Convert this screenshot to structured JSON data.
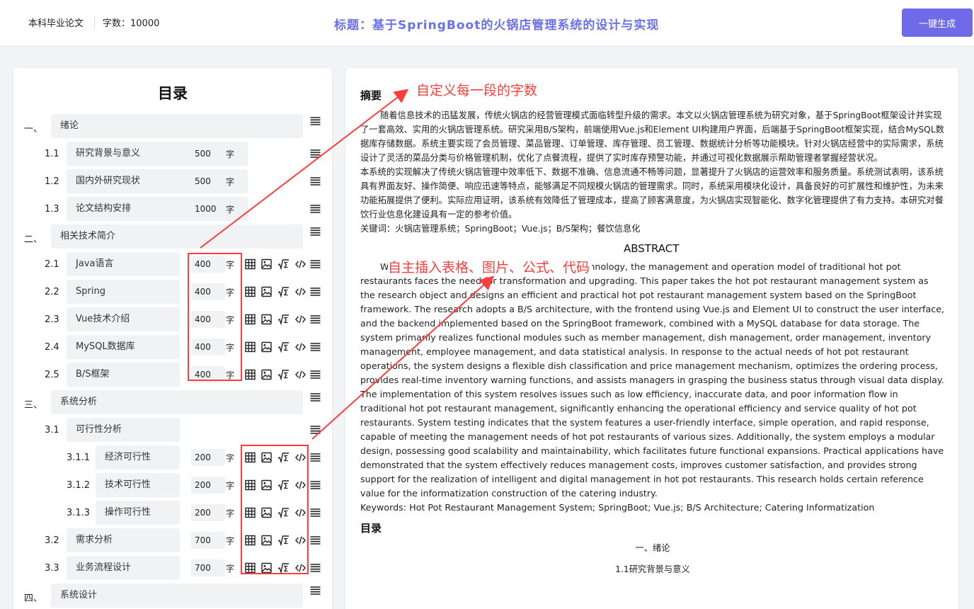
{
  "header": {
    "paper_type": "本科毕业论文",
    "word_count": "字数：10000",
    "title": "标题：基于SpringBoot的火锅店管理系统的设计与实现",
    "generate_button": "一键生成"
  },
  "toc": {
    "heading": "目录",
    "unit": "字",
    "items": [
      {
        "num": "一、",
        "label": "绪论"
      },
      {
        "num": "1.1",
        "label": "研究背景与意义",
        "words": "500"
      },
      {
        "num": "1.2",
        "label": "国内外研究现状",
        "words": "500"
      },
      {
        "num": "1.3",
        "label": "论文结构安排",
        "words": "1000"
      },
      {
        "num": "二、",
        "label": "相关技术简介"
      },
      {
        "num": "2.1",
        "label": "Java语言",
        "words": "400"
      },
      {
        "num": "2.2",
        "label": "Spring",
        "words": "400"
      },
      {
        "num": "2.3",
        "label": "Vue技术介绍",
        "words": "400"
      },
      {
        "num": "2.4",
        "label": "MySQL数据库",
        "words": "400"
      },
      {
        "num": "2.5",
        "label": "B/S框架",
        "words": "400"
      },
      {
        "num": "三、",
        "label": "系统分析"
      },
      {
        "num": "3.1",
        "label": "可行性分析"
      },
      {
        "num": "3.1.1",
        "label": "经济可行性",
        "words": "200"
      },
      {
        "num": "3.1.2",
        "label": "技术可行性",
        "words": "200"
      },
      {
        "num": "3.1.3",
        "label": "操作可行性",
        "words": "200"
      },
      {
        "num": "3.2",
        "label": "需求分析",
        "words": "700"
      },
      {
        "num": "3.3",
        "label": "业务流程设计",
        "words": "700"
      },
      {
        "num": "四、",
        "label": "系统设计"
      }
    ]
  },
  "annotations": {
    "custom_words": "自定义每一段的字数",
    "insert_media": "自主插入表格、图片、公式、代码"
  },
  "document": {
    "abstract_heading": "摘要",
    "abstract_p1": "随着信息技术的迅猛发展，传统火锅店的经营管理模式面临转型升级的需求。本文以火锅店管理系统为研究对象，基于SpringBoot框架设计并实现了一套高效、实用的火锅店管理系统。研究采用B/S架构，前端使用Vue.js和Element UI构建用户界面，后端基于SpringBoot框架实现，结合MySQL数据库存储数据。系统主要实现了会员管理、菜品管理、订单管理、库存管理、员工管理、数据统计分析等功能模块。针对火锅店经营中的实际需求，系统设计了灵活的菜品分类与价格管理机制，优化了点餐流程，提供了实时库存预警功能，并通过可视化数据展示帮助管理者掌握经营状况。",
    "abstract_p2": "本系统的实现解决了传统火锅店管理中效率低下、数据不准确、信息流通不畅等问题，显著提升了火锅店的运营效率和服务质量。系统测试表明，该系统具有界面友好、操作简便、响应迅速等特点，能够满足不同规模火锅店的管理需求。同时，系统采用模块化设计，具备良好的可扩展性和维护性，为未来功能拓展提供了便利。实际应用证明，该系统有效降低了管理成本，提高了顾客满意度，为火锅店实现智能化、数字化管理提供了有力支持。本研究对餐饮行业信息化建设具有一定的参考价值。",
    "keywords_cn": "关键词：火锅店管理系统；SpringBoot；Vue.js；B/S架构；餐饮信息化",
    "abstract_en_heading": "ABSTRACT",
    "abstract_en_p1": "With the rapid development of information technology, the management and operation model of traditional hot pot restaurants faces the need for transformation and upgrading. This paper takes the hot pot restaurant management system as the research object and designs an efficient and practical hot pot restaurant management system based on the SpringBoot framework. The research adopts a B/S architecture, with the frontend using Vue.js and Element UI to construct the user interface, and the backend implemented based on the SpringBoot framework, combined with a MySQL database for data storage. The system primarily realizes functional modules such as member management, dish management, order management, inventory management, employee management, and data statistical analysis. In response to the actual needs of hot pot restaurant operations, the system designs a flexible dish classification and price management mechanism, optimizes the ordering process, provides real-time inventory warning functions, and assists managers in grasping the business status through visual data display.",
    "abstract_en_p2": "The implementation of this system resolves issues such as low efficiency, inaccurate data, and poor information flow in traditional hot pot restaurant management, significantly enhancing the operational efficiency and service quality of hot pot restaurants. System testing indicates that the system features a user-friendly interface, simple operation, and rapid response, capable of meeting the management needs of hot pot restaurants of various sizes. Additionally, the system employs a modular design, possessing good scalability and maintainability, which facilitates future functional expansions. Practical applications have demonstrated that the system effectively reduces management costs, improves customer satisfaction, and provides strong support for the realization of intelligent and digital management in hot pot restaurants. This research holds certain reference value for the informatization construction of the catering industry.",
    "keywords_en": "Keywords: Hot Pot Restaurant Management System; SpringBoot; Vue.js; B/S Architecture; Catering Informatization",
    "toc_heading": "目录",
    "toc_line1": "一、绪论",
    "toc_line2": "1.1研究背景与意义"
  },
  "icons": {
    "insert_table": "table-icon",
    "insert_image": "image-icon",
    "insert_formula": "formula-icon",
    "insert_code": "code-icon",
    "drag_menu": "menu-icon"
  },
  "colors": {
    "accent": "#6e6ae8",
    "title": "#6a72e8",
    "annotation": "#ff3d3d"
  }
}
